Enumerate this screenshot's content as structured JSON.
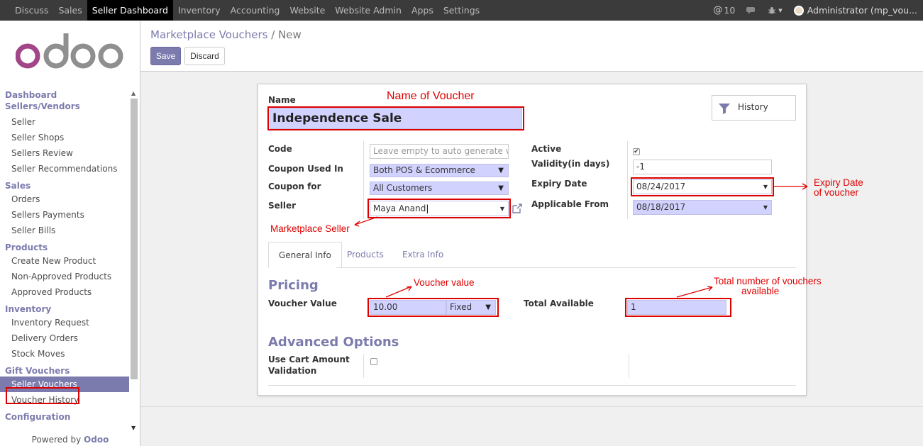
{
  "topbar": {
    "menu": [
      "Discuss",
      "Sales",
      "Seller Dashboard",
      "Inventory",
      "Accounting",
      "Website",
      "Website Admin",
      "Apps",
      "Settings"
    ],
    "active_index": 2,
    "messages_count": "10",
    "user": "Administrator (mp_vou..."
  },
  "sidebar": {
    "sections": [
      {
        "title": "Dashboard Sellers/Vendors",
        "items": [
          "Seller",
          "Seller Shops",
          "Sellers Review",
          "Seller Recommendations"
        ]
      },
      {
        "title": "Sales",
        "items": [
          "Orders",
          "Sellers Payments",
          "Seller Bills"
        ]
      },
      {
        "title": "Products",
        "items": [
          "Create New Product",
          "Non-Approved Products",
          "Approved Products"
        ]
      },
      {
        "title": "Inventory",
        "items": [
          "Inventory Request",
          "Delivery Orders",
          "Stock Moves"
        ]
      },
      {
        "title": "Gift Vouchers",
        "items": [
          "Seller Vouchers",
          "Voucher History"
        ]
      },
      {
        "title": "Configuration",
        "items": []
      }
    ],
    "powered_by": "Powered by",
    "powered_brand": "Odoo",
    "active_item": "Seller Vouchers"
  },
  "control": {
    "breadcrumb_parent": "Marketplace Vouchers",
    "breadcrumb_sep": "/",
    "breadcrumb_current": "New",
    "save_label": "Save",
    "discard_label": "Discard"
  },
  "form": {
    "name_label": "Name",
    "name_value": "Independence Sale",
    "history_label": "History",
    "code_label": "Code",
    "code_placeholder": "Leave empty to auto generate vouc",
    "coupon_used_in_label": "Coupon Used In",
    "coupon_used_in_value": "Both POS & Ecommerce",
    "coupon_for_label": "Coupon for",
    "coupon_for_value": "All Customers",
    "seller_label": "Seller",
    "seller_value": "Maya Anand",
    "active_label": "Active",
    "active_checked": true,
    "validity_label": "Validity(in days)",
    "validity_value": "-1",
    "expiry_label": "Expiry Date",
    "expiry_value": "08/24/2017",
    "applicable_label": "Applicable From",
    "applicable_value": "08/18/2017",
    "tabs": [
      "General Info",
      "Products",
      "Extra Info"
    ],
    "active_tab": 0,
    "pricing_title": "Pricing",
    "voucher_value_label": "Voucher Value",
    "voucher_value": "10.00",
    "voucher_type": "Fixed",
    "total_available_label": "Total Available",
    "total_available_value": "1",
    "advanced_title": "Advanced Options",
    "cart_validation_label_1": "Use Cart Amount",
    "cart_validation_label_2": "Validation"
  },
  "annotations": {
    "name": "Name of Voucher",
    "expiry_1": "Expiry Date",
    "expiry_2": "of voucher",
    "seller": "Marketplace Seller",
    "voucher_value": "Voucher value",
    "total_1": "Total number of vouchers",
    "total_2": "available"
  },
  "colors": {
    "brand": "#7c7bad",
    "annotation": "#e00000",
    "required_field": "#d2d2ff"
  }
}
